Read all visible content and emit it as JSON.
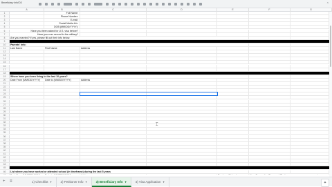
{
  "window": {
    "namebox": "Beneficiary Info!D3"
  },
  "columns": [
    "A",
    "B",
    "C",
    "D",
    "E",
    "F",
    "G",
    "H",
    "I",
    "J"
  ],
  "rows": [
    {
      "n": "1",
      "b": "Full Name:"
    },
    {
      "n": "2",
      "b": "Phone Number:"
    },
    {
      "n": "3",
      "b": "E-mail:"
    },
    {
      "n": "4",
      "b": "Social Media A/c:"
    },
    {
      "n": "5",
      "b": "DOB (MM/DD/YYYY):"
    },
    {
      "n": "6",
      "b": "Have you been asked for U.S. visa before?"
    },
    {
      "n": "7",
      "b": "Have you ever served in the military?"
    },
    {
      "n": "8",
      "a": "Are you married? If yes, please fill out their info below."
    },
    {
      "n": "9",
      "black": true
    },
    {
      "n": "10",
      "a": "Parents' Info:",
      "bold": true
    },
    {
      "n": "11",
      "a": "Last Name",
      "c": "First Name",
      "d": "Address"
    },
    {
      "n": "12"
    },
    {
      "n": "13"
    },
    {
      "n": "14"
    },
    {
      "n": "15"
    },
    {
      "n": "16"
    },
    {
      "n": "17"
    },
    {
      "n": "18",
      "black": true
    },
    {
      "n": "19",
      "a": "Where have you been living in the last 10 years?",
      "bold": true
    },
    {
      "n": "20",
      "a": "Date From (MM/DD/YYYY)",
      "c": "Date to (MM/DD/YYYY)",
      "d": "Address"
    },
    {
      "n": "21"
    },
    {
      "n": "22"
    },
    {
      "n": "23"
    },
    {
      "n": "24",
      "active": true
    },
    {
      "n": "25"
    },
    {
      "n": "26"
    },
    {
      "n": "27"
    },
    {
      "n": "28"
    },
    {
      "n": "29"
    },
    {
      "n": "30"
    },
    {
      "n": "31"
    },
    {
      "n": "32"
    },
    {
      "n": "33"
    },
    {
      "n": "34"
    },
    {
      "n": "35"
    },
    {
      "n": "36"
    },
    {
      "n": "37"
    },
    {
      "n": "38"
    },
    {
      "n": "39"
    },
    {
      "n": "40"
    },
    {
      "n": "41"
    },
    {
      "n": "42"
    },
    {
      "n": "43"
    },
    {
      "n": "44"
    },
    {
      "n": "45",
      "black": true
    },
    {
      "n": "46",
      "a": "List where you have worked or attended school (in timeframe) during the last 5 years",
      "bold": true
    },
    {
      "n": "47",
      "a": "Date From (MM/DD/YYYY)",
      "c": "Date to (MM/DD/YYYY)",
      "d": "Address",
      "f": "Employer/School",
      "h": "Your Occupation/Course of Study"
    }
  ],
  "tabs": [
    {
      "label": "1) Checklist",
      "active": false
    },
    {
      "label": "2) Petitioner Info",
      "active": false
    },
    {
      "label": "3) Beneficiary Info",
      "active": true
    },
    {
      "label": "4) Visa Application",
      "active": false
    }
  ],
  "icons": {
    "add_sheet": "plus-icon",
    "all_sheets": "menu-icon",
    "explore": "explore-icon",
    "caret": "chevron-down-icon"
  }
}
